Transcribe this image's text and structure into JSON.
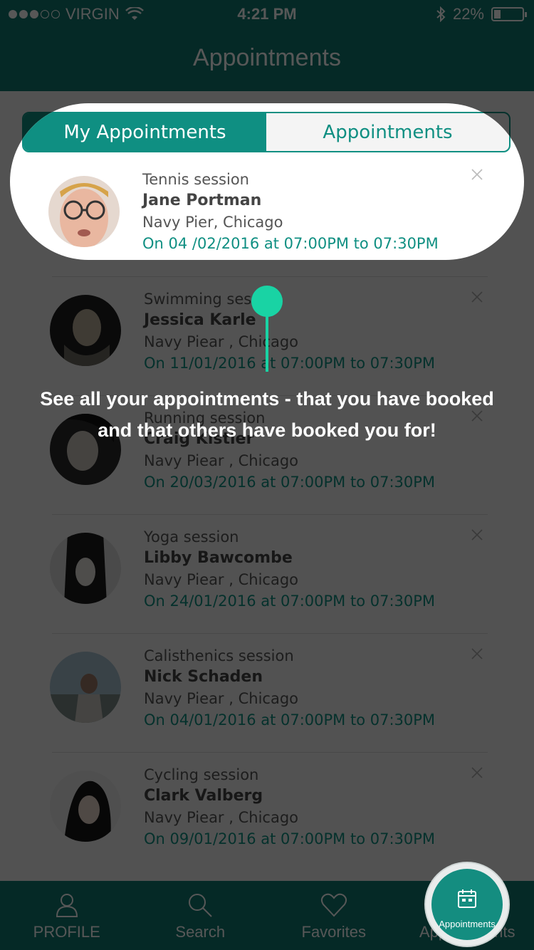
{
  "status": {
    "carrier": "VIRGIN",
    "time": "4:21 PM",
    "battery": "22%"
  },
  "nav": {
    "title": "Appointments"
  },
  "tabs": [
    {
      "label": "My Appointments"
    },
    {
      "label": "Appointments"
    }
  ],
  "highlight": {
    "session": "Tennis session",
    "name": "Jane Portman",
    "location": "Navy Pier, Chicago",
    "when": "On  04 /02/2016 at 07:00PM to 07:30PM"
  },
  "appointments": [
    {
      "session": "Swimming session",
      "name": "Jessica Karle",
      "location": "Navy Piear , Chicago",
      "when": "On  11/01/2016 at 07:00PM to 07:30PM"
    },
    {
      "session": "Running session",
      "name": "Craig Kistler",
      "location": "Navy Piear , Chicago",
      "when": "On  20/03/2016 at 07:00PM to 07:30PM"
    },
    {
      "session": "Yoga session",
      "name": "Libby Bawcombe",
      "location": "Navy Piear , Chicago",
      "when": "On  24/01/2016 at 07:00PM to 07:30PM"
    },
    {
      "session": "Calisthenics session",
      "name": "Nick Schaden",
      "location": "Navy Piear , Chicago",
      "when": "On  04/01/2016 at 07:00PM to 07:30PM"
    },
    {
      "session": "Cycling session",
      "name": "Clark Valberg",
      "location": "Navy Piear , Chicago",
      "when": "On  09/01/2016 at 07:00PM to 07:30PM"
    }
  ],
  "tooltip": {
    "text": "See all your appointments - that you have booked and that others have booked you for!"
  },
  "tabbar": [
    {
      "label": "PROFILE"
    },
    {
      "label": "Search"
    },
    {
      "label": "Favorites"
    },
    {
      "label": "Appointments"
    }
  ],
  "fab": {
    "label": "Appointments"
  },
  "colors": {
    "primary": "#0f7a71",
    "accent": "#0f8f82",
    "pin": "#19d3a4"
  }
}
